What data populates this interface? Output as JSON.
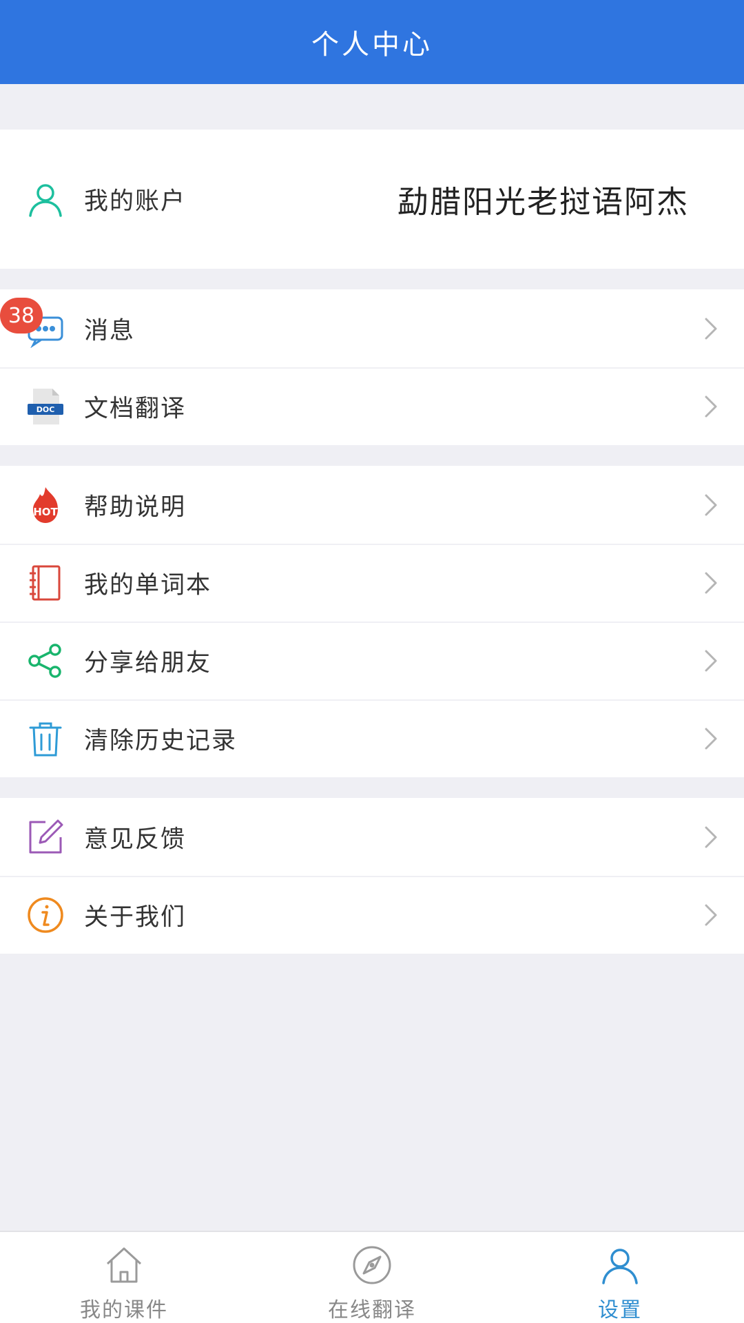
{
  "header": {
    "title": "个人中心"
  },
  "account": {
    "label": "我的账户",
    "value": "勐腊阳光老挝语阿杰",
    "icon": "user-icon"
  },
  "messages": {
    "label": "消息",
    "badge": "38",
    "icon": "message-icon"
  },
  "menu_group_a": [
    {
      "label": "文档翻译",
      "icon": "doc-file-icon"
    }
  ],
  "menu_group_b": [
    {
      "label": "帮助说明",
      "icon": "hot-flame-icon"
    },
    {
      "label": "我的单词本",
      "icon": "notebook-icon"
    },
    {
      "label": "分享给朋友",
      "icon": "share-icon"
    },
    {
      "label": "清除历史记录",
      "icon": "trash-icon"
    }
  ],
  "menu_group_c": [
    {
      "label": "意见反馈",
      "icon": "edit-icon"
    },
    {
      "label": "关于我们",
      "icon": "info-icon"
    }
  ],
  "tabbar": [
    {
      "label": "我的课件",
      "icon": "home-icon",
      "active": false
    },
    {
      "label": "在线翻译",
      "icon": "compass-icon",
      "active": false
    },
    {
      "label": "设置",
      "icon": "user-icon",
      "active": true
    }
  ],
  "colors": {
    "header_bg": "#2f75e0",
    "badge": "#e84d3d",
    "active_tab": "#2f8ed0"
  }
}
